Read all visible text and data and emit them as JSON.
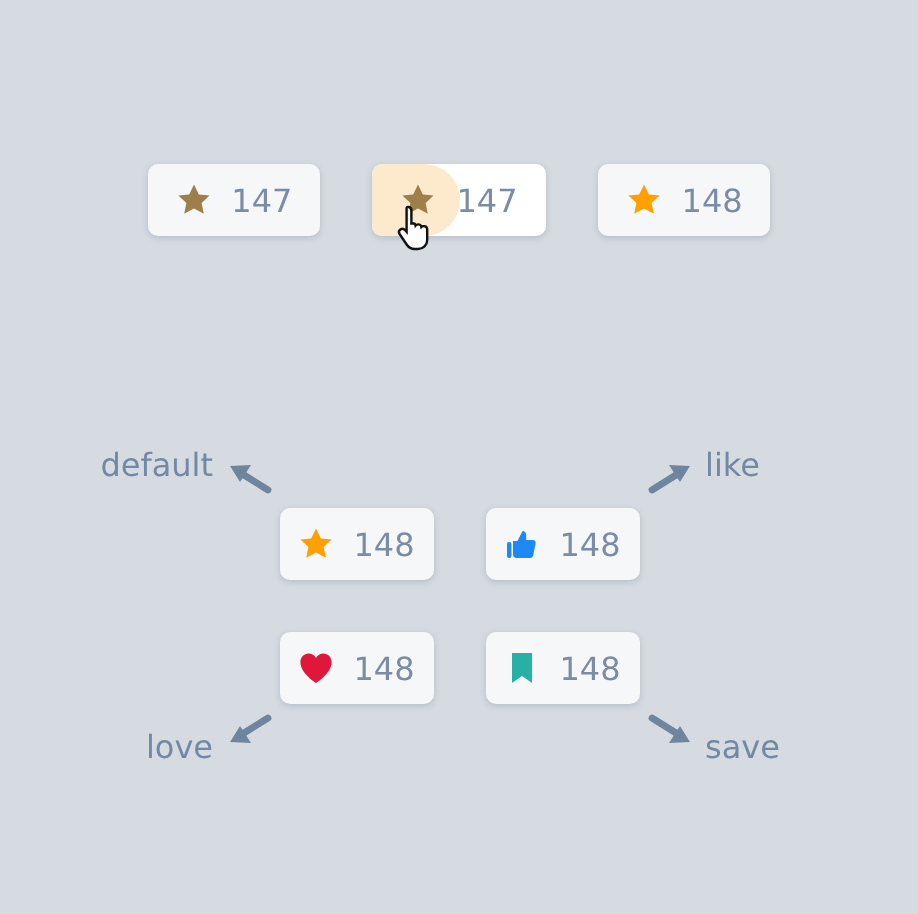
{
  "rating_buttons": [
    {
      "count": "147",
      "selected": false,
      "pressed": false
    },
    {
      "count": "147",
      "selected": false,
      "pressed": true
    },
    {
      "count": "148",
      "selected": true,
      "pressed": false
    }
  ],
  "reactions": [
    {
      "kind": "star",
      "count": "148",
      "label": "default"
    },
    {
      "kind": "thumb",
      "count": "148",
      "label": "like"
    },
    {
      "kind": "heart",
      "count": "148",
      "label": "love"
    },
    {
      "kind": "bookmark",
      "count": "148",
      "label": "save"
    }
  ]
}
